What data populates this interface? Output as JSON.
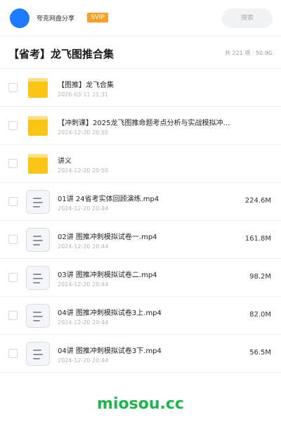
{
  "header": {
    "app_name": "夸克网盘分享",
    "badge": "SVIP",
    "search_placeholder": "搜索",
    "avatar_color": "#1f7bff"
  },
  "folder_title": {
    "title": "【省考】龙飞图推合集",
    "summary": "共 221 项 · 50.9G"
  },
  "files": [
    {
      "type": "folder",
      "icon": "folder-icon",
      "name": "【图推】龙飞合集",
      "date": "2026-03-11 21:31",
      "size": ""
    },
    {
      "type": "folder",
      "icon": "folder-icon",
      "name": "【冲刺课】2025龙飞图推命题考点分析与实战模拟冲…",
      "date": "2024-12-20 20:50",
      "size": ""
    },
    {
      "type": "folder",
      "icon": "folder-icon",
      "name": "讲义",
      "date": "2024-12-20 20:50",
      "size": ""
    },
    {
      "type": "video",
      "icon": "video-file-icon",
      "name": "01讲 24省考实体回顾演练.mp4",
      "date": "2024-12-20 20:44",
      "size": "224.6M"
    },
    {
      "type": "video",
      "icon": "video-file-icon",
      "name": "02讲 图推冲刺模拟试卷一.mp4",
      "date": "2024-12-20 20:44",
      "size": "161.8M"
    },
    {
      "type": "video",
      "icon": "video-file-icon",
      "name": "03讲 图推冲刺模拟试卷二.mp4",
      "date": "2024-12-20 20:44",
      "size": "98.2M"
    },
    {
      "type": "video",
      "icon": "video-file-icon",
      "name": "04讲 图推冲刺模拟试卷3上.mp4",
      "date": "2024-12-20 20:44",
      "size": "82.0M"
    },
    {
      "type": "video",
      "icon": "video-file-icon",
      "name": "04讲 图推冲刺模拟试卷3下.mp4",
      "date": "2024-12-20 20:44",
      "size": "56.5M"
    }
  ],
  "watermark": {
    "text": "miosou.cc",
    "color": "#20b34e"
  },
  "colors": {
    "badge_bg": "#f4a12b",
    "folder_yellow": "#fcc419"
  }
}
